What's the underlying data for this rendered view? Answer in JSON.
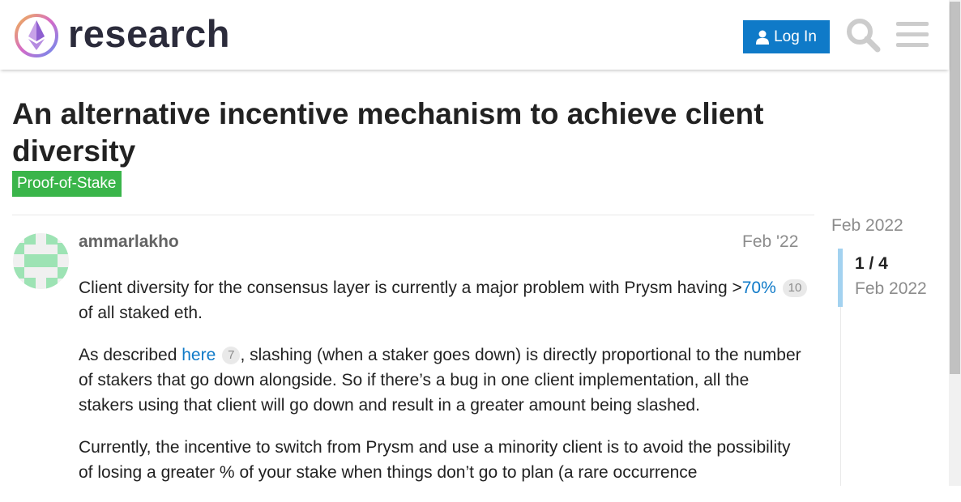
{
  "header": {
    "site_name": "research",
    "login_label": "Log In",
    "icons": [
      "ethereum-logo",
      "user-icon",
      "search-icon",
      "hamburger-menu-icon"
    ]
  },
  "topic": {
    "title": "An alternative incentive mechanism to achieve client diversity",
    "category": "Proof-of-Stake",
    "category_color": "#3ab54a"
  },
  "post": {
    "username": "ammarlakho",
    "date": "Feb '22",
    "p1_before": "Client diversity for the consensus layer is currently a major problem with Prysm having >",
    "p1_link": "70%",
    "p1_clicks": "10",
    "p1_after": " of all staked eth.",
    "p2_before": "As described ",
    "p2_link": "here",
    "p2_clicks": "7",
    "p2_after": ", slashing (when a staker goes down) is directly proportional to the number of stakers that go down alongside. So if there’s a bug in one client implementation, all the stakers using that client will go down and result in a greater amount being slashed.",
    "p3": "Currently, the incentive to switch from Prysm and use a minority client is to avoid the possibility of losing a greater % of your stake when things don’t go to plan (a rare occurrence"
  },
  "timeline": {
    "top_date": "Feb 2022",
    "position": "1 / 4",
    "current_date": "Feb 2022"
  },
  "colors": {
    "accent": "#0f7ac8",
    "avatar": "#9de3b4"
  }
}
